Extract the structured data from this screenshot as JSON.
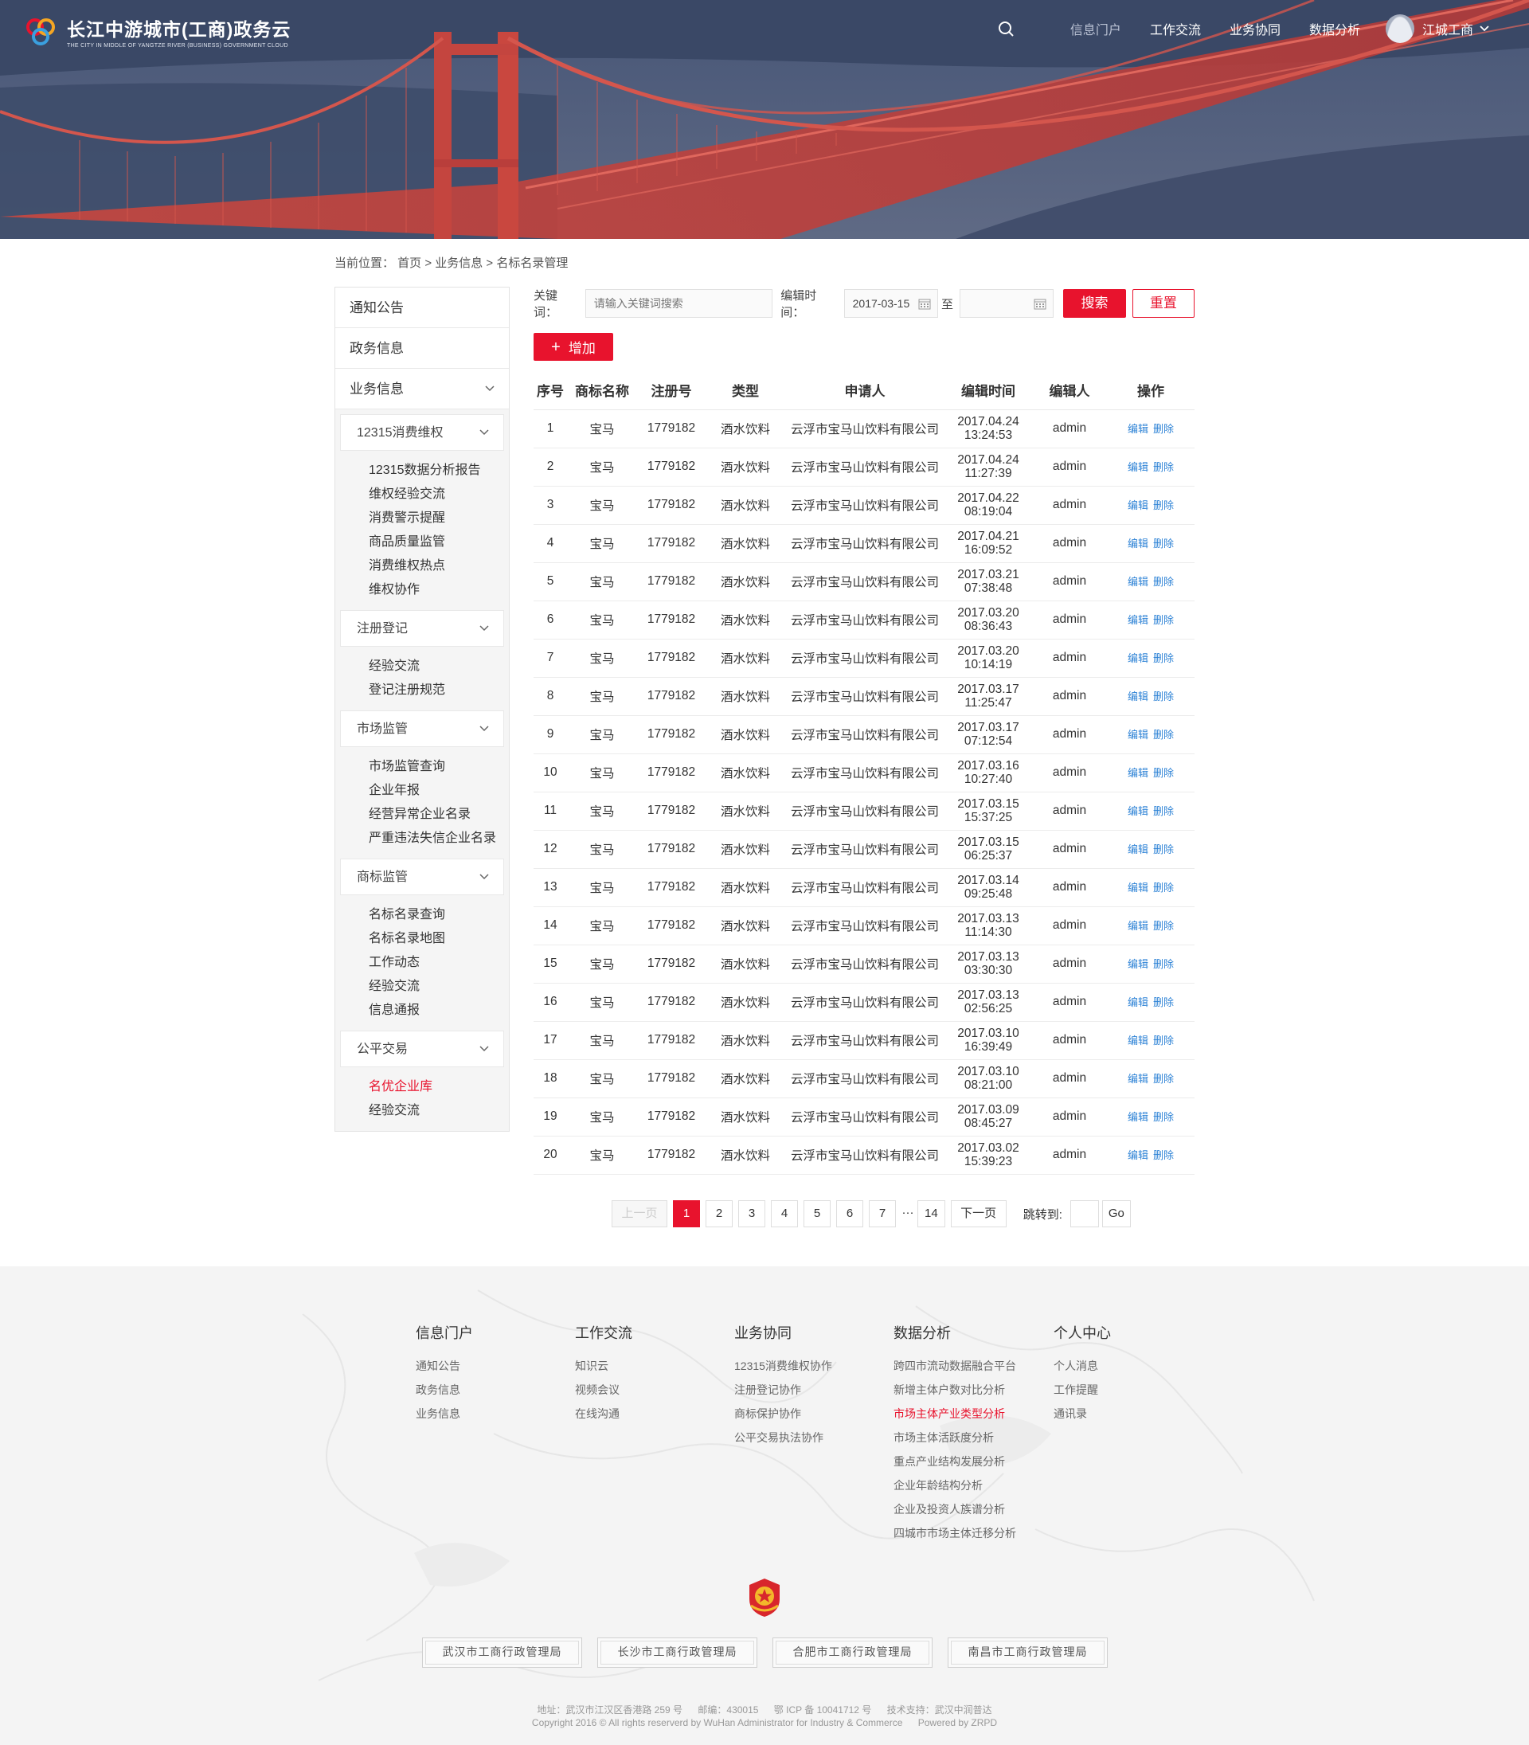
{
  "header": {
    "logo_title": "长江中游城市(工商)政务云",
    "logo_subtitle": "THE CITY IN MIDDLE OF YANGTZE RIVER (BUSINESS) GOVERNMENT CLOUD",
    "nav": [
      "信息门户",
      "工作交流",
      "业务协同",
      "数据分析"
    ],
    "user_name": "江城工商"
  },
  "breadcrumb": "当前位置： 首页 > 业务信息 > 名标名录管理",
  "sidebar": {
    "top_items": [
      "通知公告",
      "政务信息"
    ],
    "expanded_item": "业务信息",
    "groups": [
      {
        "title": "12315消费维权",
        "items": [
          "12315数据分析报告",
          "维权经验交流",
          "消费警示提醒",
          "商品质量监管",
          "消费维权热点",
          "维权协作"
        ]
      },
      {
        "title": "注册登记",
        "items": [
          "经验交流",
          "登记注册规范"
        ]
      },
      {
        "title": "市场监管",
        "items": [
          "市场监管查询",
          "企业年报",
          "经营异常企业名录",
          "严重违法失信企业名录"
        ]
      },
      {
        "title": "商标监管",
        "items": [
          "名标名录查询",
          "名标名录地图",
          "工作动态",
          "经验交流",
          "信息通报"
        ]
      },
      {
        "title": "公平交易",
        "items": [
          "名优企业库",
          "经验交流"
        ]
      }
    ]
  },
  "filters": {
    "keyword_label": "关键词：",
    "keyword_placeholder": "请输入关键词搜索",
    "time_label": "编辑时间：",
    "date_from": "2017-03-15",
    "to_label": "至",
    "date_to": "",
    "search_btn": "搜索",
    "reset_btn": "重置"
  },
  "add_btn": "增加",
  "table": {
    "headers": [
      "序号",
      "商标名称",
      "注册号",
      "类型",
      "申请人",
      "编辑时间",
      "编辑人",
      "操作"
    ],
    "edit_label": "编辑",
    "delete_label": "删除",
    "rows": [
      {
        "seq": "1",
        "name": "宝马",
        "reg": "1779182",
        "type": "酒水饮料",
        "applicant": "云浮市宝马山饮料有限公司",
        "date": "2017.04.24",
        "time": "13:24:53",
        "editor": "admin"
      },
      {
        "seq": "2",
        "name": "宝马",
        "reg": "1779182",
        "type": "酒水饮料",
        "applicant": "云浮市宝马山饮料有限公司",
        "date": "2017.04.24",
        "time": "11:27:39",
        "editor": "admin"
      },
      {
        "seq": "3",
        "name": "宝马",
        "reg": "1779182",
        "type": "酒水饮料",
        "applicant": "云浮市宝马山饮料有限公司",
        "date": "2017.04.22",
        "time": "08:19:04",
        "editor": "admin"
      },
      {
        "seq": "4",
        "name": "宝马",
        "reg": "1779182",
        "type": "酒水饮料",
        "applicant": "云浮市宝马山饮料有限公司",
        "date": "2017.04.21",
        "time": "16:09:52",
        "editor": "admin"
      },
      {
        "seq": "5",
        "name": "宝马",
        "reg": "1779182",
        "type": "酒水饮料",
        "applicant": "云浮市宝马山饮料有限公司",
        "date": "2017.03.21",
        "time": "07:38:48",
        "editor": "admin"
      },
      {
        "seq": "6",
        "name": "宝马",
        "reg": "1779182",
        "type": "酒水饮料",
        "applicant": "云浮市宝马山饮料有限公司",
        "date": "2017.03.20",
        "time": "08:36:43",
        "editor": "admin"
      },
      {
        "seq": "7",
        "name": "宝马",
        "reg": "1779182",
        "type": "酒水饮料",
        "applicant": "云浮市宝马山饮料有限公司",
        "date": "2017.03.20",
        "time": "10:14:19",
        "editor": "admin"
      },
      {
        "seq": "8",
        "name": "宝马",
        "reg": "1779182",
        "type": "酒水饮料",
        "applicant": "云浮市宝马山饮料有限公司",
        "date": "2017.03.17",
        "time": "11:25:47",
        "editor": "admin"
      },
      {
        "seq": "9",
        "name": "宝马",
        "reg": "1779182",
        "type": "酒水饮料",
        "applicant": "云浮市宝马山饮料有限公司",
        "date": "2017.03.17",
        "time": "07:12:54",
        "editor": "admin"
      },
      {
        "seq": "10",
        "name": "宝马",
        "reg": "1779182",
        "type": "酒水饮料",
        "applicant": "云浮市宝马山饮料有限公司",
        "date": "2017.03.16",
        "time": "10:27:40",
        "editor": "admin"
      },
      {
        "seq": "11",
        "name": "宝马",
        "reg": "1779182",
        "type": "酒水饮料",
        "applicant": "云浮市宝马山饮料有限公司",
        "date": "2017.03.15",
        "time": "15:37:25",
        "editor": "admin"
      },
      {
        "seq": "12",
        "name": "宝马",
        "reg": "1779182",
        "type": "酒水饮料",
        "applicant": "云浮市宝马山饮料有限公司",
        "date": "2017.03.15",
        "time": "06:25:37",
        "editor": "admin"
      },
      {
        "seq": "13",
        "name": "宝马",
        "reg": "1779182",
        "type": "酒水饮料",
        "applicant": "云浮市宝马山饮料有限公司",
        "date": "2017.03.14",
        "time": "09:25:48",
        "editor": "admin"
      },
      {
        "seq": "14",
        "name": "宝马",
        "reg": "1779182",
        "type": "酒水饮料",
        "applicant": "云浮市宝马山饮料有限公司",
        "date": "2017.03.13",
        "time": "11:14:30",
        "editor": "admin"
      },
      {
        "seq": "15",
        "name": "宝马",
        "reg": "1779182",
        "type": "酒水饮料",
        "applicant": "云浮市宝马山饮料有限公司",
        "date": "2017.03.13",
        "time": "03:30:30",
        "editor": "admin"
      },
      {
        "seq": "16",
        "name": "宝马",
        "reg": "1779182",
        "type": "酒水饮料",
        "applicant": "云浮市宝马山饮料有限公司",
        "date": "2017.03.13",
        "time": "02:56:25",
        "editor": "admin"
      },
      {
        "seq": "17",
        "name": "宝马",
        "reg": "1779182",
        "type": "酒水饮料",
        "applicant": "云浮市宝马山饮料有限公司",
        "date": "2017.03.10",
        "time": "16:39:49",
        "editor": "admin"
      },
      {
        "seq": "18",
        "name": "宝马",
        "reg": "1779182",
        "type": "酒水饮料",
        "applicant": "云浮市宝马山饮料有限公司",
        "date": "2017.03.10",
        "time": "08:21:00",
        "editor": "admin"
      },
      {
        "seq": "19",
        "name": "宝马",
        "reg": "1779182",
        "type": "酒水饮料",
        "applicant": "云浮市宝马山饮料有限公司",
        "date": "2017.03.09",
        "time": "08:45:27",
        "editor": "admin"
      },
      {
        "seq": "20",
        "name": "宝马",
        "reg": "1779182",
        "type": "酒水饮料",
        "applicant": "云浮市宝马山饮料有限公司",
        "date": "2017.03.02",
        "time": "15:39:23",
        "editor": "admin"
      }
    ]
  },
  "pagination": {
    "prev": "上一页",
    "pages": [
      "1",
      "2",
      "3",
      "4",
      "5",
      "6",
      "7"
    ],
    "ellipsis": "···",
    "last": "14",
    "current": "1",
    "next": "下一页",
    "jump_label": "跳转到:",
    "go": "Go"
  },
  "footer": {
    "columns": [
      {
        "title": "信息门户",
        "links": [
          "通知公告",
          "政务信息",
          "业务信息"
        ]
      },
      {
        "title": "工作交流",
        "links": [
          "知识云",
          "视频会议",
          "在线沟通"
        ]
      },
      {
        "title": "业务协同",
        "links": [
          "12315消费维权协作",
          "注册登记协作",
          "商标保护协作",
          "公平交易执法协作"
        ]
      },
      {
        "title": "数据分析",
        "links": [
          "跨四市流动数据融合平台",
          "新增主体户数对比分析",
          "市场主体产业类型分析",
          "市场主体活跃度分析",
          "重点产业结构发展分析",
          "企业年龄结构分析",
          "企业及投资人族谱分析",
          "四城市市场主体迁移分析"
        ],
        "highlight_index": 2
      },
      {
        "title": "个人中心",
        "links": [
          "个人消息",
          "工作提醒",
          "通讯录"
        ]
      }
    ],
    "bureaus": [
      "武汉市工商行政管理局",
      "长沙市工商行政管理局",
      "合肥市工商行政管理局",
      "南昌市工商行政管理局"
    ],
    "address": "地址：武汉市江汉区香港路 259 号",
    "postcode": "邮编：430015",
    "icp": "鄂 ICP 备 10041712 号",
    "tech": "技术支持：武汉中润普达",
    "copyright": "Copyright 2016 © All rights reserverd by WuHan Administrator for Industry & Commerce",
    "powered": "Powered by ZRPD"
  },
  "colors": {
    "accent": "#e8132d",
    "link": "#2e83d6",
    "bridge": "#c8413b"
  }
}
